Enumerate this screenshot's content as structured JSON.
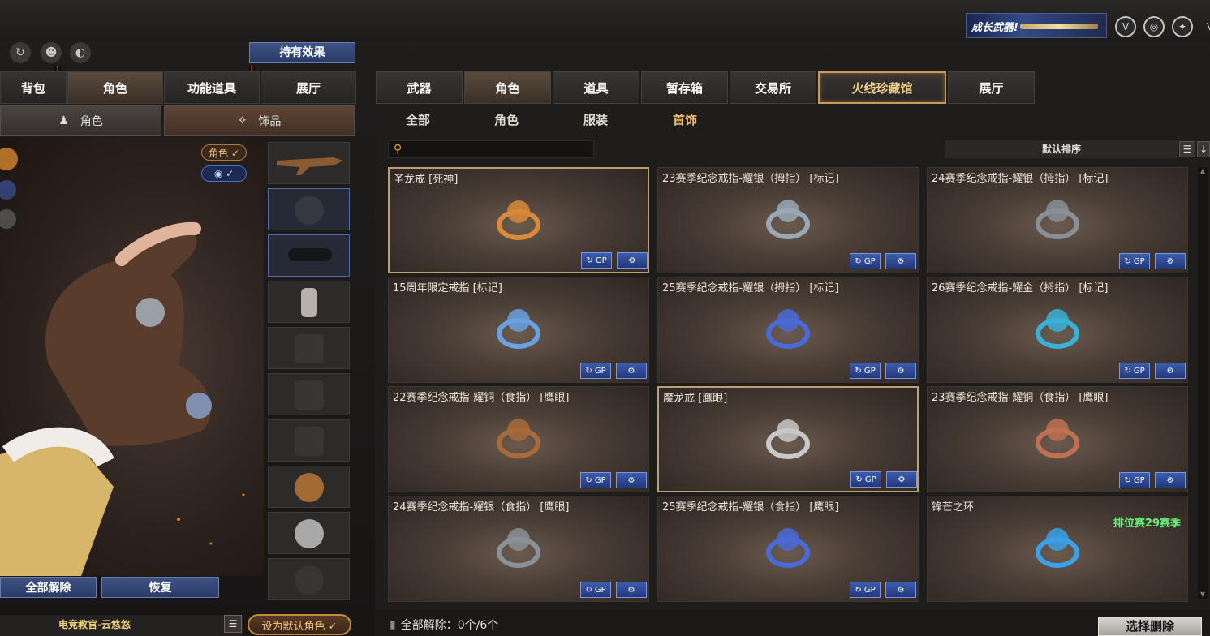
{
  "top": {
    "banner_text": "成长武器!",
    "icons": [
      "v-badge-icon",
      "target-icon",
      "crosshair-icon",
      "v-icon"
    ]
  },
  "left": {
    "icons": [
      "refresh-icon",
      "character-icon",
      "bag-icon"
    ],
    "hold_effect_label": "持有效果",
    "tabs": [
      {
        "label": "背包"
      },
      {
        "label": "角色"
      },
      {
        "label": "功能道具"
      },
      {
        "label": "展厅"
      }
    ],
    "subtabs": [
      {
        "label": "角色"
      },
      {
        "label": "饰品"
      }
    ],
    "pill_role": "角色 ✓",
    "pill_eye": "✓",
    "unequip_all_label": "全部解除",
    "restore_label": "恢复",
    "player_name": "电竞教官-云悠悠",
    "set_default_label": "设为默认角色 ✓"
  },
  "right": {
    "tabs": [
      {
        "label": "武器"
      },
      {
        "label": "角色"
      },
      {
        "label": "道具"
      },
      {
        "label": "暂存箱"
      },
      {
        "label": "交易所"
      },
      {
        "label": "火线珍藏馆"
      },
      {
        "label": "展厅"
      }
    ],
    "subtabs": [
      {
        "label": "全部"
      },
      {
        "label": "角色"
      },
      {
        "label": "服装"
      },
      {
        "label": "首饰"
      }
    ],
    "search_placeholder": "",
    "sort_label": "默认排序",
    "items": [
      {
        "title": "圣龙戒 [死神]",
        "color": "#d88a3a"
      },
      {
        "title": "23赛季纪念戒指-耀银（拇指） [标记]",
        "color": "#9aa8b6"
      },
      {
        "title": "24赛季纪念戒指-耀银（拇指） [标记]",
        "color": "#8a8f96"
      },
      {
        "title": "15周年限定戒指 [标记]",
        "color": "#6aa0e0"
      },
      {
        "title": "25赛季纪念戒指-耀银（拇指） [标记]",
        "color": "#4a6ad8"
      },
      {
        "title": "26赛季纪念戒指-耀金（拇指） [标记]",
        "color": "#3ab0d8"
      },
      {
        "title": "22赛季纪念戒指-耀铜（食指） [鹰眼]",
        "color": "#a86a3a"
      },
      {
        "title": "魔龙戒 [鹰眼]",
        "color": "#c8c8c8"
      },
      {
        "title": "23赛季纪念戒指-耀铜（食指） [鹰眼]",
        "color": "#c07050"
      },
      {
        "title": "24赛季纪念戒指-耀银（食指） [鹰眼]",
        "color": "#8a9098"
      },
      {
        "title": "25赛季纪念戒指-耀银（食指） [鹰眼]",
        "color": "#4a6ad8"
      },
      {
        "title": "锋芒之环",
        "color": "#3aa0e8",
        "badge": "排位赛29赛季"
      }
    ],
    "unequip_count_label": "全部解除：0个/6个",
    "select_delete_label": "选择删除"
  }
}
